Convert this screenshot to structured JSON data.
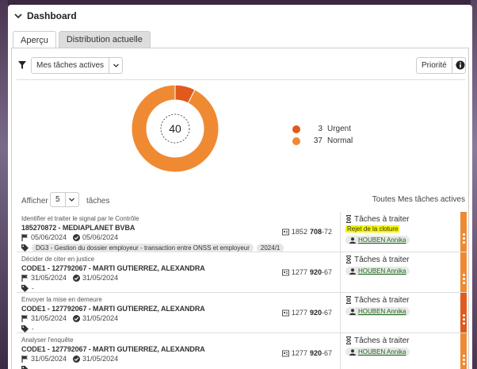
{
  "panel": {
    "title": "Dashboard"
  },
  "tabs": [
    {
      "label": "Aperçu",
      "active": true
    },
    {
      "label": "Distribution actuelle",
      "active": false
    }
  ],
  "filter": {
    "selected": "Mes tâches actives",
    "sort": "Priorité"
  },
  "chart_data": {
    "type": "pie",
    "center_label": "40",
    "slices": [
      {
        "name": "Urgent",
        "value": 3,
        "color": "#e05a1c"
      },
      {
        "name": "Normal",
        "value": 37,
        "color": "#ef8a33"
      }
    ]
  },
  "show": {
    "label": "Afficher",
    "count": "5",
    "suffix": "tâches",
    "right_label": "Toutes Mes tâches actives"
  },
  "items": [
    {
      "type": "Identifier et traiter le signal par le Contrôle",
      "title": "185270872 - MEDIAPLANET BVBA",
      "date1": "05/06/2024",
      "date2": "05/06/2024",
      "amount_prefix": "1852",
      "amount_bold": "708",
      "amount_suffix": "-72",
      "tags": [
        "DG3 - Gestion du dossier employeur - transaction entre ONSS et employeur",
        "2024/1"
      ],
      "status": "Tâches à traiter",
      "note": "Rejet de la cloture",
      "assignee": "HOUBEN Annika",
      "prio_color": "#ef8a33"
    },
    {
      "type": "Décider de citer en justice",
      "title": "CODE1 - 127792067 - MARTI GUTIERREZ, ALEXANDRA",
      "date1": "31/05/2024",
      "date2": "31/05/2024",
      "amount_prefix": "1277",
      "amount_bold": "920",
      "amount_suffix": "-67",
      "tags": [
        "-"
      ],
      "status": "Tâches à traiter",
      "note": "",
      "assignee": "HOUBEN Annika",
      "prio_color": "#ef8a33"
    },
    {
      "type": "Envoyer la mise en demeure",
      "title": "CODE1 - 127792067 - MARTI GUTIERREZ, ALEXANDRA",
      "date1": "31/05/2024",
      "date2": "31/05/2024",
      "amount_prefix": "1277",
      "amount_bold": "920",
      "amount_suffix": "-67",
      "tags": [
        "-"
      ],
      "status": "Tâches à traiter",
      "note": "",
      "assignee": "HOUBEN Annika",
      "prio_color": "#e05a1c"
    },
    {
      "type": "Analyser l'enquête",
      "title": "CODE1 - 127792067 - MARTI GUTIERREZ, ALEXANDRA",
      "date1": "31/05/2024",
      "date2": "31/05/2024",
      "amount_prefix": "1277",
      "amount_bold": "920",
      "amount_suffix": "-67",
      "tags": [
        "-"
      ],
      "status": "Tâches à traiter",
      "note": "",
      "assignee": "HOUBEN Annika",
      "prio_color": "#ef8a33"
    }
  ]
}
